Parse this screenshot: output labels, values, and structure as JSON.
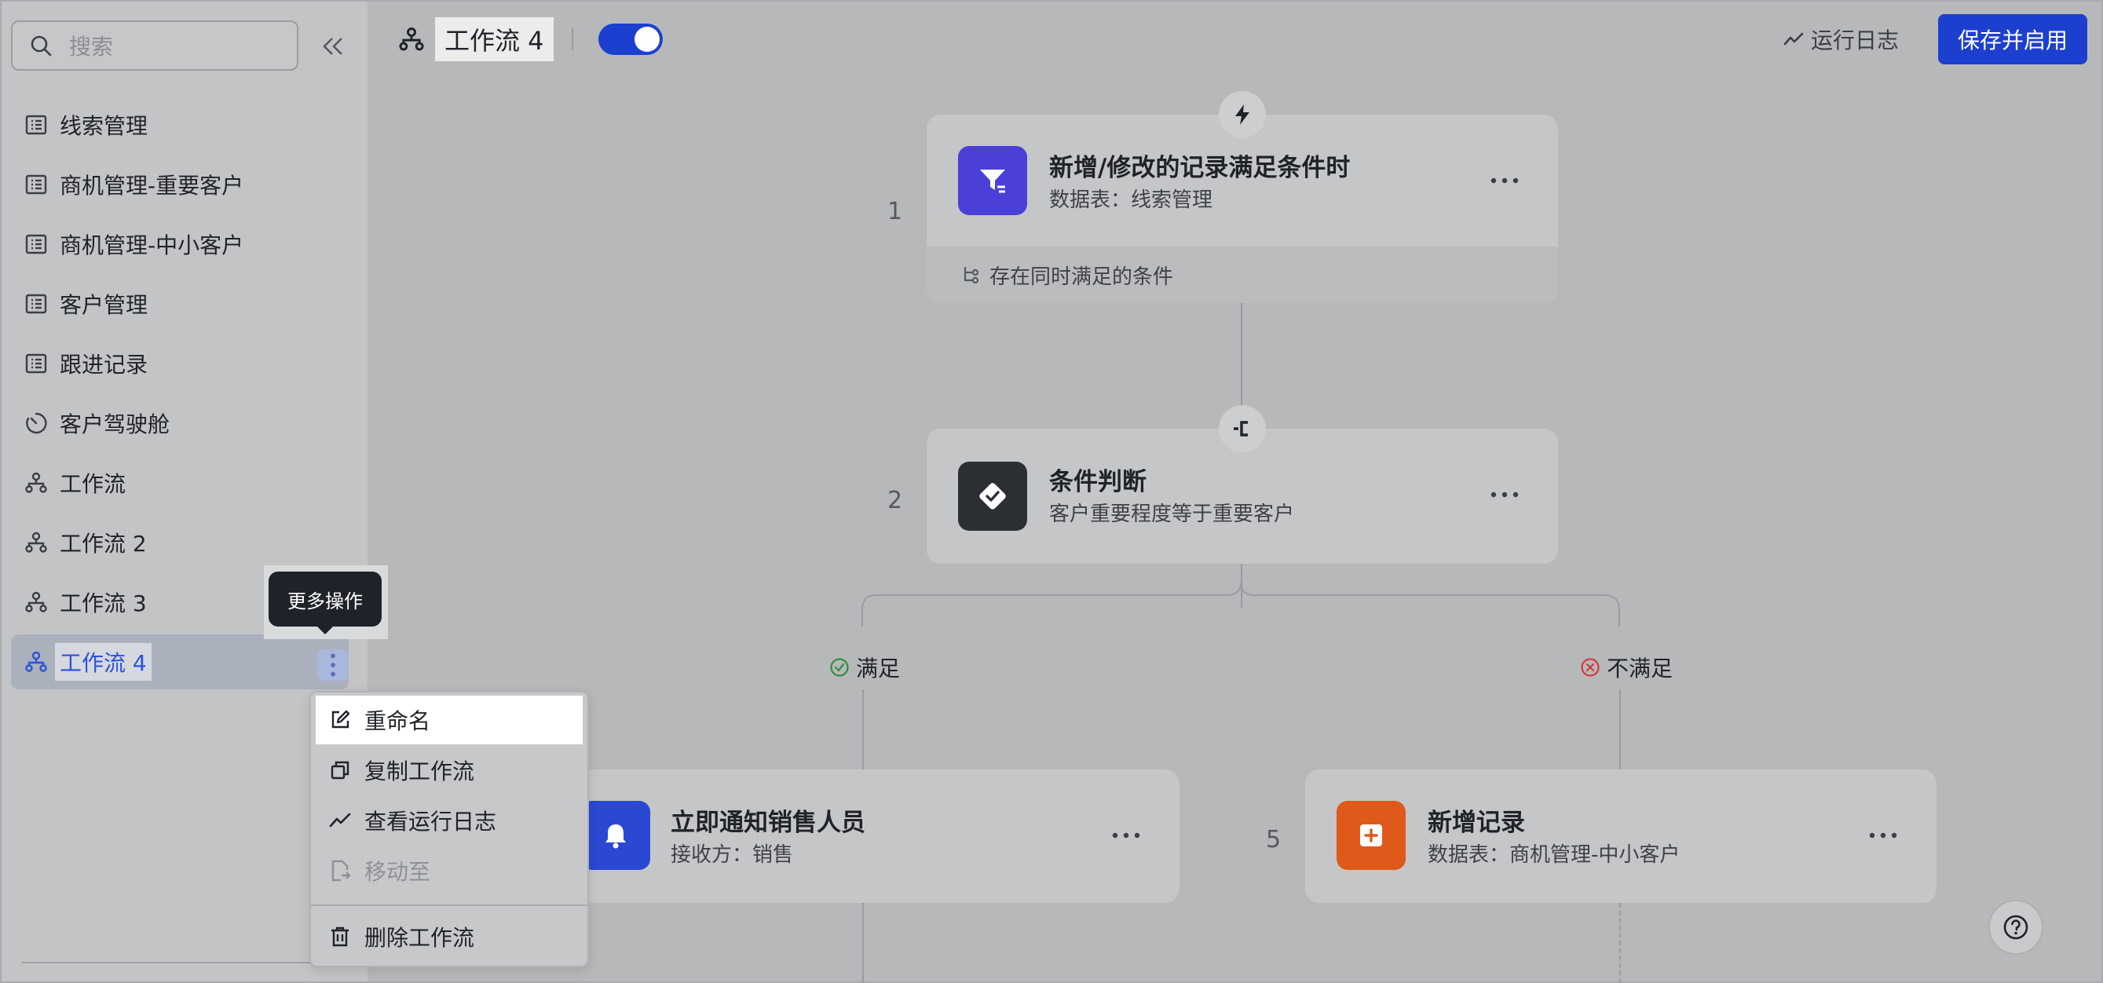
{
  "sidebar": {
    "search_placeholder": "搜索",
    "items": [
      {
        "label": "线索管理",
        "icon": "table-icon"
      },
      {
        "label": "商机管理-重要客户",
        "icon": "table-icon"
      },
      {
        "label": "商机管理-中小客户",
        "icon": "table-icon"
      },
      {
        "label": "客户管理",
        "icon": "table-icon"
      },
      {
        "label": "跟进记录",
        "icon": "table-icon"
      },
      {
        "label": "客户驾驶舱",
        "icon": "dashboard-icon"
      },
      {
        "label": "工作流",
        "icon": "workflow-icon"
      },
      {
        "label": "工作流 2",
        "icon": "workflow-icon"
      },
      {
        "label": "工作流 3",
        "icon": "workflow-icon"
      },
      {
        "label": "工作流 4",
        "icon": "workflow-icon",
        "active": true
      }
    ]
  },
  "tooltip": {
    "text": "更多操作"
  },
  "context_menu": {
    "items": [
      {
        "label": "重命名",
        "icon": "edit-icon",
        "highlighted": true
      },
      {
        "label": "复制工作流",
        "icon": "copy-icon"
      },
      {
        "label": "查看运行日志",
        "icon": "chart-line-icon"
      },
      {
        "label": "移动至",
        "icon": "move-icon",
        "disabled": true
      },
      {
        "label": "删除工作流",
        "icon": "trash-icon"
      }
    ]
  },
  "header": {
    "title": "工作流 4",
    "enabled": true,
    "log_label": "运行日志",
    "save_label": "保存并启用"
  },
  "flow": {
    "trigger": {
      "step": "1",
      "title": "新增/修改的记录满足条件时",
      "subtitle": "数据表：线索管理",
      "footer": "存在同时满足的条件"
    },
    "condition": {
      "step": "2",
      "title": "条件判断",
      "subtitle": "客户重要程度等于重要客户"
    },
    "branch_yes": "满足",
    "branch_no": "不满足",
    "notify": {
      "title": "立即通知销售人员",
      "subtitle": "接收方：销售"
    },
    "add_record": {
      "step": "5",
      "title": "新增记录",
      "subtitle": "数据表：商机管理-中小客户"
    }
  },
  "colors": {
    "accent": "#1d3fd0",
    "trigger_icon": "#4a3fd6",
    "condition_icon": "#2b2e33",
    "notify_icon": "#2a48d2",
    "add_icon": "#e0591a",
    "success": "#2f8f3a",
    "danger": "#d33b3b"
  }
}
